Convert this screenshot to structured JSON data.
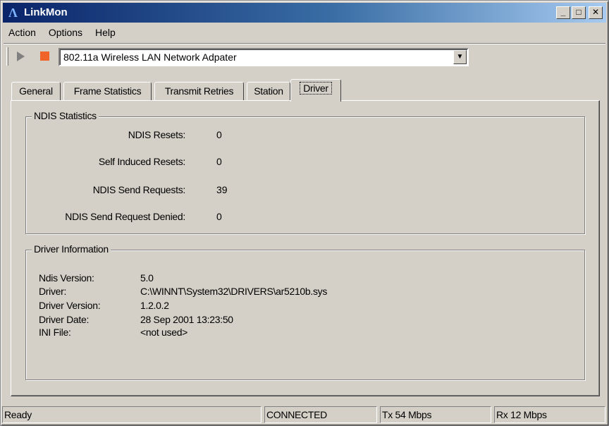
{
  "window": {
    "title": "LinkMon"
  },
  "menu": [
    "Action",
    "Options",
    "Help"
  ],
  "toolbar": {
    "adapter": "802.11a Wireless LAN Network Adpater"
  },
  "tabs": [
    "General",
    "Frame Statistics",
    "Transmit Retries",
    "Station",
    "Driver"
  ],
  "active_tab": "Driver",
  "ndis_statistics": {
    "title": "NDIS Statistics",
    "rows": [
      {
        "label": "NDIS Resets:",
        "value": "0"
      },
      {
        "label": "Self Induced Resets:",
        "value": "0"
      },
      {
        "label": "NDIS Send Requests:",
        "value": "39"
      },
      {
        "label": "NDIS Send Request Denied:",
        "value": "0"
      }
    ]
  },
  "driver_information": {
    "title": "Driver Information",
    "rows": [
      {
        "label": "Ndis Version:",
        "value": "5.0"
      },
      {
        "label": "Driver:",
        "value": "C:\\WINNT\\System32\\DRIVERS\\ar5210b.sys"
      },
      {
        "label": "Driver Version:",
        "value": "1.2.0.2"
      },
      {
        "label": "Driver Date:",
        "value": "28 Sep 2001 13:23:50"
      },
      {
        "label": "INI File:",
        "value": "<not used>"
      }
    ]
  },
  "statusbar": {
    "status": "Ready",
    "connection": "CONNECTED",
    "tx": "Tx 54 Mbps",
    "rx": "Rx 12 Mbps"
  },
  "colors": {
    "titlebar": "#0a246a",
    "stop_button": "#f0642a",
    "face": "#d4d0c8"
  }
}
